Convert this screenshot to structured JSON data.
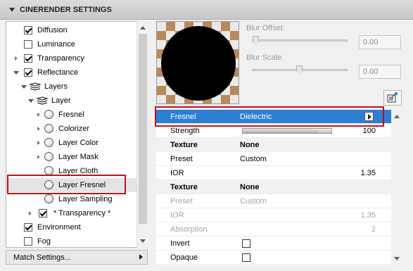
{
  "panel": {
    "title": "CINERENDER SETTINGS"
  },
  "tree": {
    "items": [
      {
        "label": "Diffusion",
        "checked": true,
        "type": "checkbox"
      },
      {
        "label": "Luminance",
        "checked": false,
        "type": "checkbox"
      },
      {
        "label": "Transparency",
        "checked": true,
        "type": "checkbox"
      },
      {
        "label": "Reflectance",
        "checked": true,
        "type": "checkbox"
      },
      {
        "label": "Layers",
        "type": "layers"
      },
      {
        "label": "Layer",
        "type": "layers"
      },
      {
        "label": "Fresnel",
        "type": "sphere"
      },
      {
        "label": "Colorizer",
        "type": "sphere"
      },
      {
        "label": "Layer Color",
        "type": "sphere"
      },
      {
        "label": "Layer Mask",
        "type": "sphere"
      },
      {
        "label": "Layer Cloth",
        "type": "sphere"
      },
      {
        "label": "Layer Fresnel",
        "type": "sphere",
        "selected": true
      },
      {
        "label": "Layer Sampling",
        "type": "sphere"
      },
      {
        "label": "* Transparency *",
        "checked": true,
        "type": "checkbox"
      },
      {
        "label": "Environment",
        "checked": true,
        "type": "checkbox"
      },
      {
        "label": "Fog",
        "checked": false,
        "type": "checkbox"
      }
    ]
  },
  "match_settings": {
    "label": "Match Settings..."
  },
  "preview": {
    "blur_offset": {
      "label": "Blur Offset:",
      "value": "0.00"
    },
    "blur_scale": {
      "label": "Blur Scale:",
      "value": "0.00"
    }
  },
  "props": {
    "fresnel": {
      "key": "Fresnel",
      "value": "Dielectric"
    },
    "strength": {
      "key": "Strength",
      "value": "100",
      "fraction": 0.85
    },
    "texture1": {
      "key": "Texture",
      "value": "None"
    },
    "preset1": {
      "key": "Preset",
      "value": "Custom"
    },
    "ior1": {
      "key": "IOR",
      "value": "1.35"
    },
    "texture2": {
      "key": "Texture",
      "value": "None"
    },
    "preset2": {
      "key": "Preset",
      "value": "Custom"
    },
    "ior2": {
      "key": "IOR",
      "value": "1.35"
    },
    "absorption": {
      "key": "Absorption",
      "value": "2"
    },
    "invert": {
      "key": "Invert",
      "checked": false
    },
    "opaque": {
      "key": "Opaque",
      "checked": false
    }
  },
  "colors": {
    "highlight": "#2e7ed6",
    "callout": "#b8141a",
    "preview_checker": "#b8895a"
  }
}
